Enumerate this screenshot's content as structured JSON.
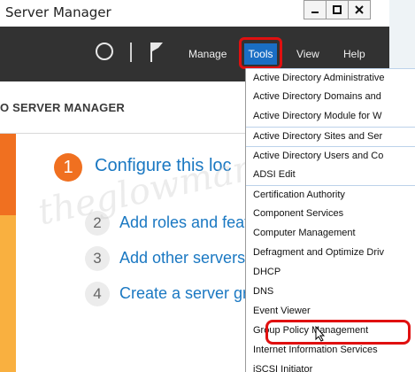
{
  "window": {
    "title": "Server Manager"
  },
  "toolbar": {
    "menu": [
      {
        "label": "Manage"
      },
      {
        "label": "Tools"
      },
      {
        "label": "View"
      },
      {
        "label": "Help"
      }
    ]
  },
  "page": {
    "title": "O SERVER MANAGER",
    "steps": [
      {
        "number": "1",
        "label": "Configure this loc"
      },
      {
        "number": "2",
        "label": "Add roles and featu"
      },
      {
        "number": "3",
        "label": "Add other servers"
      },
      {
        "number": "4",
        "label": "Create a server gr"
      }
    ],
    "watermark": "theglowmany.com"
  },
  "tools_menu": {
    "items": [
      "Active Directory Administrative",
      "Active Directory Domains and",
      "Active Directory Module for W",
      "Active Directory Sites and Ser",
      "Active Directory Users and Co",
      "ADSI Edit",
      "Certification Authority",
      "Component Services",
      "Computer Management",
      "Defragment and Optimize Driv",
      "DHCP",
      "DNS",
      "Event Viewer",
      "Group Policy Management",
      "Internet Information Services",
      "iSCSI Initiator"
    ],
    "highlighted": "Group Policy Management"
  },
  "colors": {
    "toolbar": "#323232",
    "accent_orange": "#f07020",
    "link_blue": "#1a78c2",
    "highlight_red": "#e01010"
  }
}
